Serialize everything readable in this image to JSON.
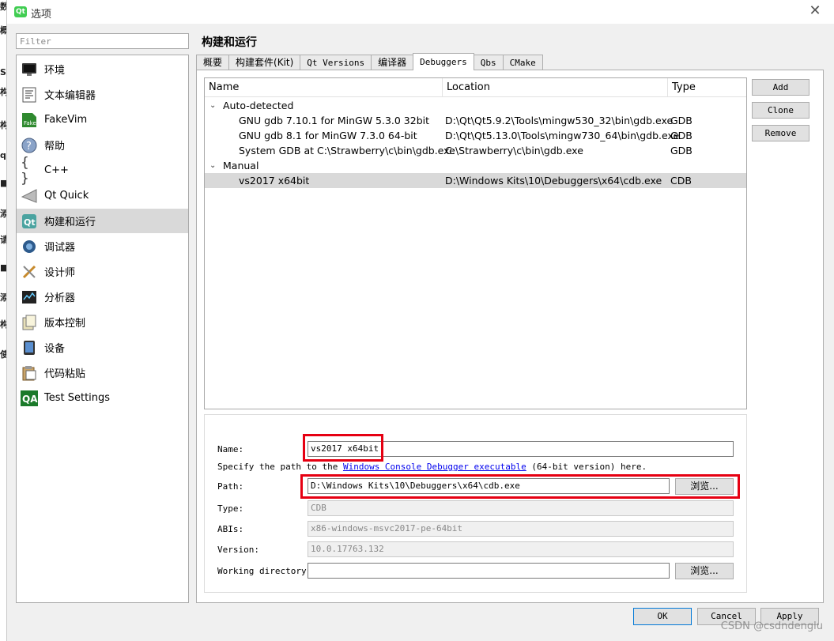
{
  "window": {
    "title": "选项",
    "app_icon_text": "Qt"
  },
  "filter": {
    "placeholder": "Filter"
  },
  "categories": [
    {
      "label": "环境",
      "icon": "monitor-icon"
    },
    {
      "label": "文本编辑器",
      "icon": "text-editor-icon"
    },
    {
      "label": "FakeVim",
      "icon": "fakevim-icon"
    },
    {
      "label": "帮助",
      "icon": "help-icon"
    },
    {
      "label": "C++",
      "icon": "braces-icon"
    },
    {
      "label": "Qt Quick",
      "icon": "qt-quick-icon"
    },
    {
      "label": "构建和运行",
      "icon": "build-run-icon",
      "selected": true
    },
    {
      "label": "调试器",
      "icon": "debugger-icon"
    },
    {
      "label": "设计师",
      "icon": "designer-icon"
    },
    {
      "label": "分析器",
      "icon": "analyzer-icon"
    },
    {
      "label": "版本控制",
      "icon": "version-control-icon"
    },
    {
      "label": "设备",
      "icon": "device-icon"
    },
    {
      "label": "代码粘贴",
      "icon": "code-paste-icon"
    },
    {
      "label": "Test Settings",
      "icon": "qa-icon"
    }
  ],
  "page_title": "构建和运行",
  "tabs": [
    {
      "label": "概要"
    },
    {
      "label": "构建套件(Kit)"
    },
    {
      "label": "Qt Versions"
    },
    {
      "label": "编译器"
    },
    {
      "label": "Debuggers",
      "active": true
    },
    {
      "label": "Qbs"
    },
    {
      "label": "CMake"
    }
  ],
  "tree": {
    "columns": [
      "Name",
      "Location",
      "Type"
    ],
    "groups": [
      {
        "label": "Auto-detected",
        "rows": [
          {
            "name": "GNU gdb 7.10.1 for MinGW 5.3.0 32bit",
            "location": "D:\\Qt\\Qt5.9.2\\Tools\\mingw530_32\\bin\\gdb.exe",
            "type": "GDB"
          },
          {
            "name": "GNU gdb 8.1 for MinGW 7.3.0 64-bit",
            "location": "D:\\Qt\\Qt5.13.0\\Tools\\mingw730_64\\bin\\gdb.exe",
            "type": "GDB"
          },
          {
            "name": "System GDB at C:\\Strawberry\\c\\bin\\gdb.exe",
            "location": "C:\\Strawberry\\c\\bin\\gdb.exe",
            "type": "GDB"
          }
        ]
      },
      {
        "label": "Manual",
        "rows": [
          {
            "name": "vs2017 x64bit",
            "location": "D:\\Windows Kits\\10\\Debuggers\\x64\\cdb.exe",
            "type": "CDB",
            "selected": true
          }
        ]
      }
    ]
  },
  "side_buttons": {
    "add": "Add",
    "clone": "Clone",
    "remove": "Remove"
  },
  "details": {
    "name_label": "Name:",
    "name_value": "vs2017 x64bit",
    "hint_before": "Specify the path to the ",
    "hint_link": "Windows Console Debugger executable",
    "hint_after": " (64-bit version) here.",
    "path_label": "Path:",
    "path_value": "D:\\Windows Kits\\10\\Debuggers\\x64\\cdb.exe",
    "browse_label": "浏览...",
    "type_label": "Type:",
    "type_value": "CDB",
    "abis_label": "ABIs:",
    "abis_value": "x86-windows-msvc2017-pe-64bit",
    "version_label": "Version:",
    "version_value": "10.0.17763.132",
    "workdir_label": "Working directory:",
    "workdir_value": ""
  },
  "footer": {
    "ok": "OK",
    "cancel": "Cancel",
    "apply": "Apply"
  },
  "watermark": "CSDN @csdndenglu",
  "colors": {
    "highlight_red": "#e60012",
    "selection_gray": "#d9d9d9",
    "link_blue": "#0000ee"
  }
}
